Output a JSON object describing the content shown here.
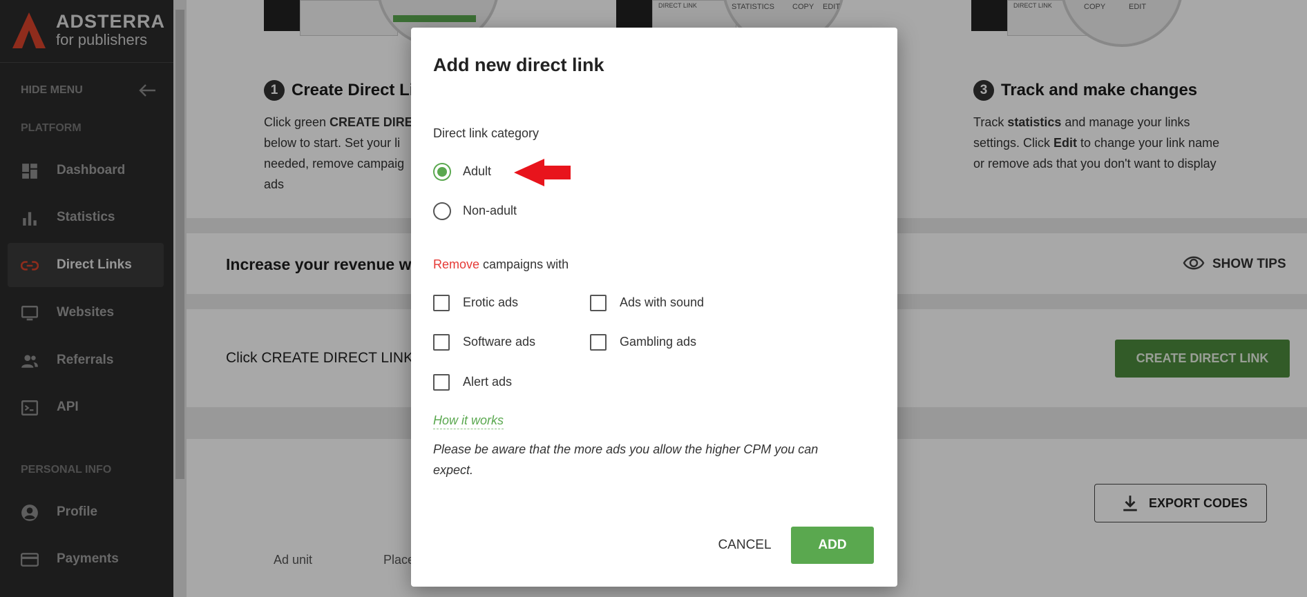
{
  "sidebar": {
    "brand": "ADSTERRA",
    "brand_sub": "for publishers",
    "hide_menu": "HIDE MENU",
    "section_platform": "PLATFORM",
    "section_personal": "PERSONAL INFO",
    "items": [
      {
        "label": "Dashboard",
        "icon": "dashboard-icon"
      },
      {
        "label": "Statistics",
        "icon": "bar-chart-icon"
      },
      {
        "label": "Direct Links",
        "icon": "link-icon"
      },
      {
        "label": "Websites",
        "icon": "monitor-icon"
      },
      {
        "label": "Referrals",
        "icon": "people-icon"
      },
      {
        "label": "API",
        "icon": "terminal-icon"
      },
      {
        "label": "Profile",
        "icon": "user-icon"
      },
      {
        "label": "Payments",
        "icon": "card-icon"
      }
    ]
  },
  "steps": [
    {
      "num": "1",
      "title": "Create Direct Li",
      "desc_prefix": "Click green ",
      "desc_bold": "CREATE DIRE",
      "desc_lines": [
        "below to start. Set your li",
        "needed, remove campaig",
        "ads"
      ]
    },
    {
      "num": "3",
      "title": "Track and make changes",
      "desc_line1_prefix": "Track ",
      "desc_line1_bold": "statistics",
      "desc_line1_suffix": " and manage your links",
      "desc_line2_prefix": "settings. Click ",
      "desc_line2_bold": "Edit",
      "desc_line2_suffix": " to change your link name",
      "desc_line3": "or remove ads that you don't want to display"
    }
  ],
  "thumbs": {
    "t2_left": "DIRECT LINK",
    "t2_mid": "STATISTICS",
    "t2_copy": "COPY",
    "t2_edit": "EDIT",
    "t3_left": "DIRECT LINK",
    "t3_copy": "COPY",
    "t3_edit": "EDIT"
  },
  "main": {
    "bar_title": "Increase your revenue w",
    "show_tips": "SHOW TIPS",
    "click_text": "Click CREATE DIRECT LINK",
    "create_button": "CREATE DIRECT LINK",
    "export_button": "EXPORT CODES",
    "columns": [
      "Ad unit",
      "Place"
    ]
  },
  "dialog": {
    "title": "Add new direct link",
    "category_label": "Direct link category",
    "categories": [
      {
        "label": "Adult",
        "checked": true
      },
      {
        "label": "Non-adult",
        "checked": false
      }
    ],
    "remove_word": "Remove",
    "remove_rest": " campaigns with",
    "options": [
      {
        "label": "Erotic ads",
        "checked": false
      },
      {
        "label": "Ads with sound",
        "checked": false
      },
      {
        "label": "Software ads",
        "checked": false
      },
      {
        "label": "Gambling ads",
        "checked": false
      },
      {
        "label": "Alert ads",
        "checked": false
      }
    ],
    "how_link": "How it works",
    "note": "Please be aware that the more ads you allow the higher CPM you can expect.",
    "cancel": "CANCEL",
    "add": "ADD"
  },
  "colors": {
    "accent_green": "#5aa84f",
    "create_green": "#4d8a3d",
    "remove_red": "#e53935",
    "logo_red": "#d9432b",
    "annotation_arrow": "#e8141c"
  }
}
